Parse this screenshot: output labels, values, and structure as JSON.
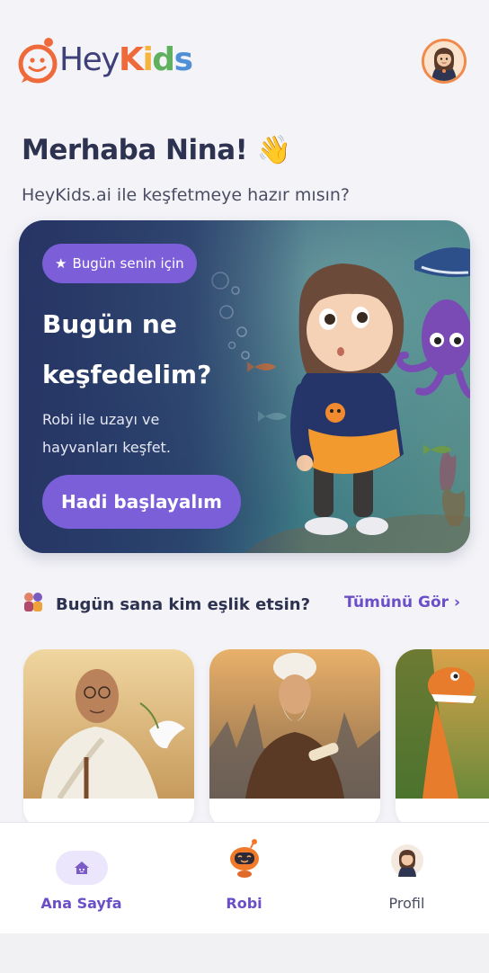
{
  "header": {
    "logo_text_hey": "Hey",
    "logo_text_kids": [
      "K",
      "i",
      "d",
      "s"
    ]
  },
  "greeting": {
    "title": "Merhaba Nina! 👋",
    "subtitle": "HeyKids.ai ile keşfetmeye hazır mısın?"
  },
  "hero": {
    "badge": "Bugün senin için",
    "title_line1": "Bugün ne",
    "title_line2": "keşfedelim?",
    "desc_line1": "Robi ile uzayı ve",
    "desc_line2": "hayvanları keşfet.",
    "cta": "Hadi başlayalım"
  },
  "companions": {
    "title": "Bugün sana kim eşlik etsin?",
    "see_all": "Tümünü Gör ›"
  },
  "tabbar": {
    "items": [
      {
        "label": "Ana Sayfa",
        "active": true
      },
      {
        "label": "Robi",
        "active": false
      },
      {
        "label": "Profil",
        "active": false
      }
    ]
  },
  "colors": {
    "accent": "#7b5fd9",
    "text_dark": "#2d3250",
    "link": "#6b4fc8",
    "logo_orange": "#ef6a3a"
  }
}
